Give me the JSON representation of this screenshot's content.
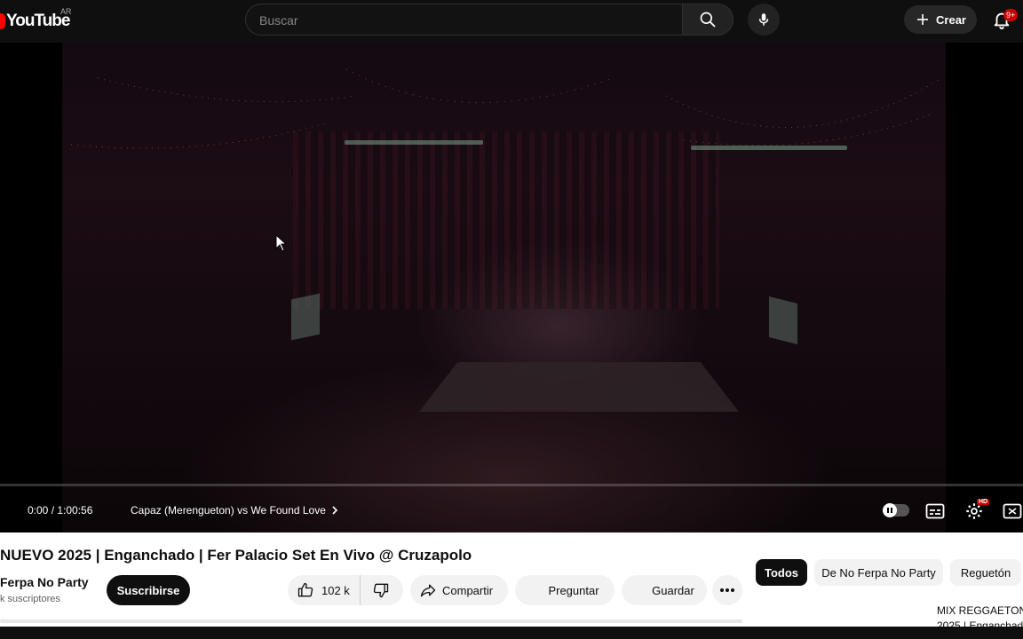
{
  "header": {
    "logo_text": "YouTube",
    "country_code": "AR",
    "search_placeholder": "Buscar",
    "create_label": "Crear",
    "notification_badge": "9+"
  },
  "player": {
    "time": "0:00 / 1:00:56",
    "chapter": "Capaz (Merengueton) vs We Found Love",
    "progress": 0,
    "hd_badge": "HD"
  },
  "video": {
    "title": "NUEVO 2025 | Enganchado | Fer Palacio Set En Vivo @ Cruzapolo",
    "channel_name": "Ferpa No Party",
    "subscribers": "k suscriptores",
    "subscribe_label": "Suscribirse",
    "likes": "102 k",
    "share_label": "Compartir",
    "ask_label": "Preguntar",
    "save_label": "Guardar"
  },
  "chips": [
    "Todos",
    "De No Ferpa No Party",
    "Reguetón"
  ],
  "recommendation": {
    "title_line1": "MIX REGGAETON",
    "title_line2": "2025 | Enganchado"
  },
  "colors": {
    "brand_red": "#ff0000",
    "badge_red": "#cc0000",
    "dark_bg": "#0f0f0f"
  }
}
